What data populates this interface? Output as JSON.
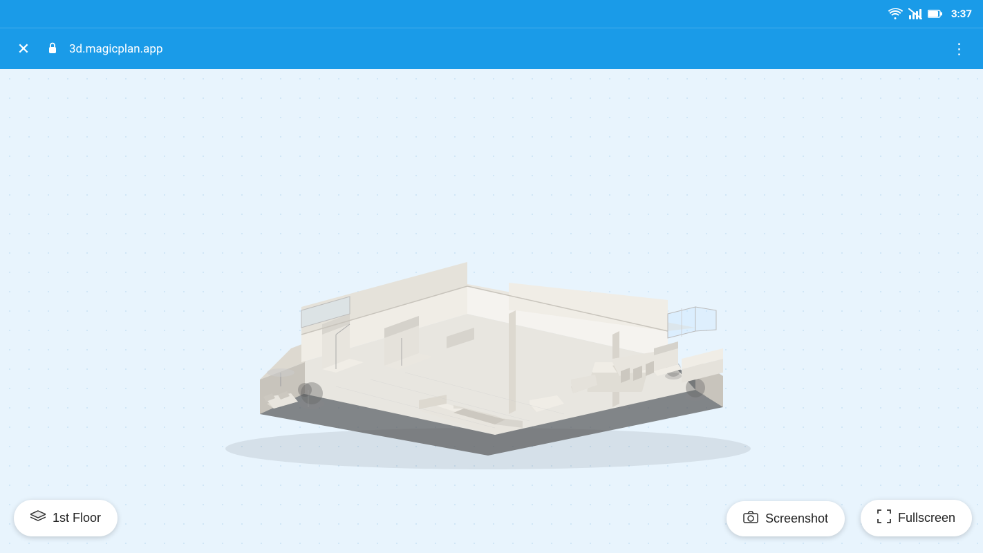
{
  "status_bar": {
    "time": "3:37",
    "wifi_icon": "wifi",
    "signal_icon": "signal",
    "battery_icon": "battery"
  },
  "app_bar": {
    "close_label": "✕",
    "lock_icon": "🔒",
    "url": "3d.magicplan.app",
    "menu_icon": "⋮"
  },
  "floor_button": {
    "label": "1st Floor",
    "icon": "layers"
  },
  "screenshot_button": {
    "label": "Screenshot",
    "icon": "camera"
  },
  "fullscreen_button": {
    "label": "Fullscreen",
    "icon": "fullscreen"
  }
}
